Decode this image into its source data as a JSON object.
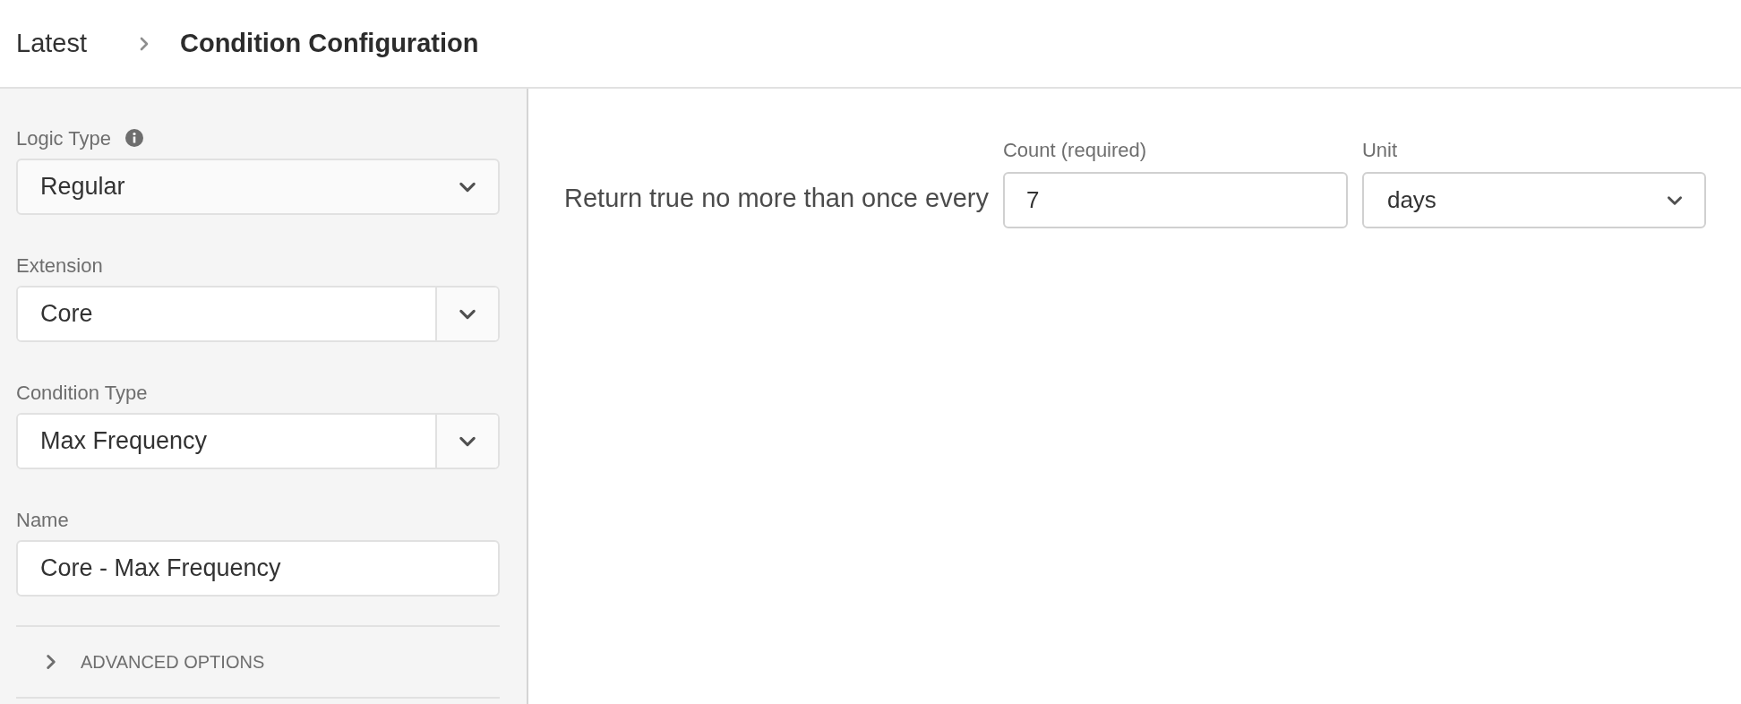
{
  "breadcrumb": [
    {
      "label": "Latest",
      "current": false
    },
    {
      "label": "Condition Configuration",
      "current": true
    }
  ],
  "sidebar": {
    "fields": [
      {
        "kind": "dropdown",
        "label": "Logic Type",
        "info": true,
        "value": "Regular"
      },
      {
        "kind": "combobox",
        "label": "Extension",
        "info": false,
        "value": "Core"
      },
      {
        "kind": "combobox",
        "label": "Condition Type",
        "info": false,
        "value": "Max Frequency"
      },
      {
        "kind": "textfield",
        "label": "Name",
        "info": false,
        "value": "Core - Max Frequency"
      }
    ],
    "advanced": {
      "label": "ADVANCED OPTIONS",
      "expanded": false
    }
  },
  "main": {
    "sentence": "Return true no more than once every",
    "count": {
      "label": "Count (required)",
      "value": "7"
    },
    "unit": {
      "label": "Unit",
      "value": "days"
    }
  }
}
